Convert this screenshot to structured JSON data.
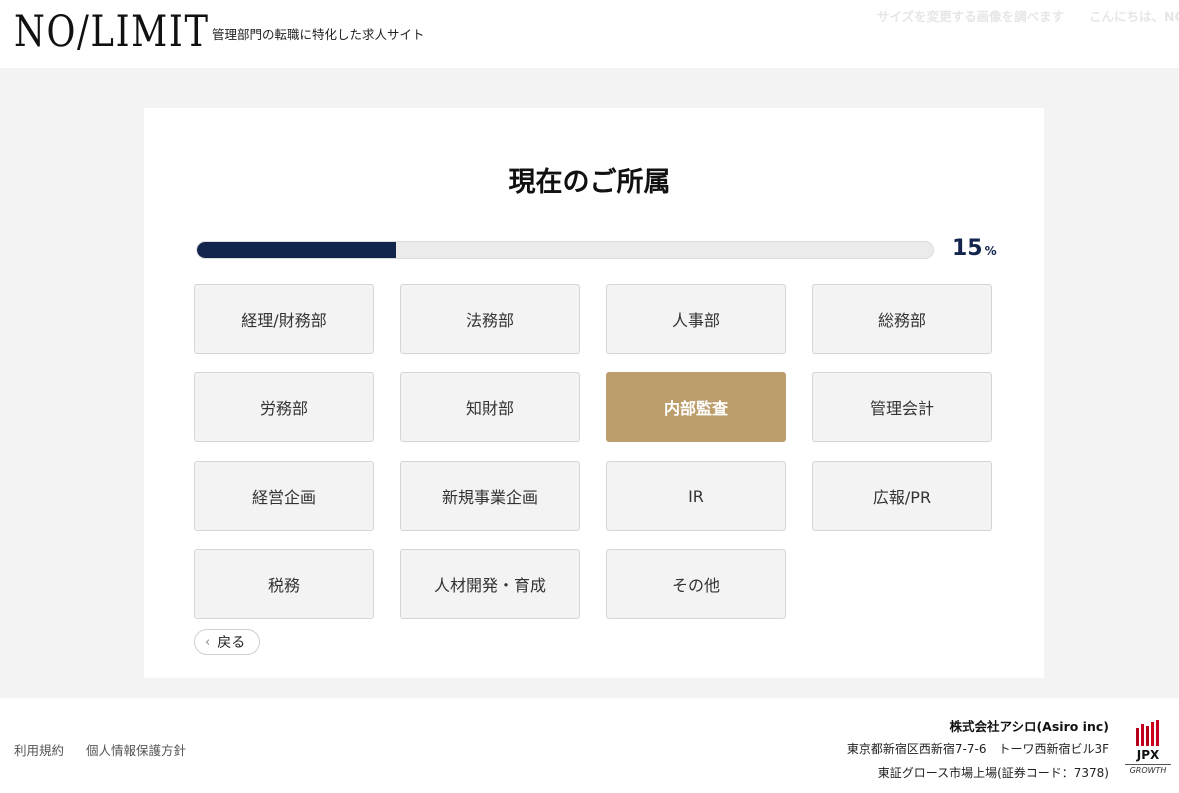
{
  "header": {
    "logo": "NO/LIMIT",
    "tagline": "管理部門の転職に特化した求人サイト",
    "ghost_text_1": "サイズを変更する画像を調べます",
    "ghost_text_2": "こんにちは、NO"
  },
  "main": {
    "title": "現在のご所属",
    "progress": {
      "value": "15",
      "unit": "%",
      "fill_fraction": 0.27,
      "color": "#13244d"
    },
    "options": [
      {
        "label": "経理/財務部",
        "selected": false
      },
      {
        "label": "法務部",
        "selected": false
      },
      {
        "label": "人事部",
        "selected": false
      },
      {
        "label": "総務部",
        "selected": false
      },
      {
        "label": "労務部",
        "selected": false
      },
      {
        "label": "知財部",
        "selected": false
      },
      {
        "label": "内部監査",
        "selected": true
      },
      {
        "label": "管理会計",
        "selected": false
      },
      {
        "label": "経営企画",
        "selected": false
      },
      {
        "label": "新規事業企画",
        "selected": false
      },
      {
        "label": "IR",
        "selected": false
      },
      {
        "label": "広報/PR",
        "selected": false
      },
      {
        "label": "税務",
        "selected": false
      },
      {
        "label": "人材開発・育成",
        "selected": false
      },
      {
        "label": "その他",
        "selected": false
      }
    ],
    "selected_color": "#bc9e6d",
    "back_label": "戻る"
  },
  "footer": {
    "terms_link": "利用規約",
    "privacy_link": "個人情報保護方針",
    "company": "株式会社アシロ(Asiro inc)",
    "address": "東京都新宿区西新宿7-7-6　トーワ西新宿ビル3F",
    "listing": "東証グロース市場上場(証券コード：7378)",
    "jpx_label": "JPX",
    "jpx_sub": "GROWTH"
  }
}
